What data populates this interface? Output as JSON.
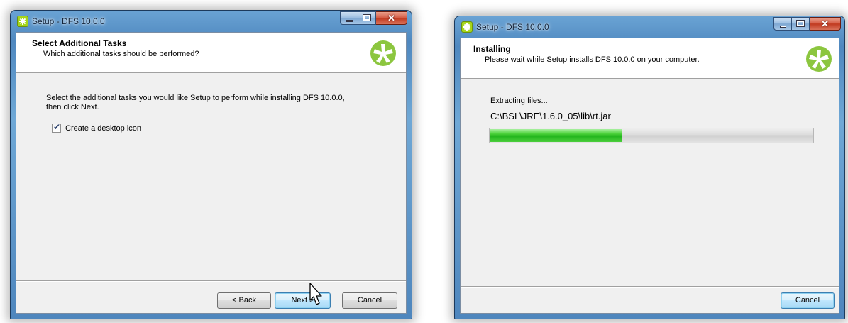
{
  "left_window": {
    "title": "Setup - DFS 10.0.0",
    "header": {
      "title": "Select Additional Tasks",
      "subtitle": "Which additional tasks should be performed?"
    },
    "instruction_line1": "Select the additional tasks you would like Setup to perform while installing DFS 10.0.0,",
    "instruction_line2": "then click Next.",
    "checkbox": {
      "label": "Create a desktop icon",
      "checked": true
    },
    "buttons": {
      "back": "< Back",
      "next": "Next >",
      "cancel": "Cancel"
    }
  },
  "right_window": {
    "title": "Setup - DFS 10.0.0",
    "header": {
      "title": "Installing",
      "subtitle": "Please wait while Setup installs DFS 10.0.0 on your computer."
    },
    "status": "Extracting files...",
    "current_file": "C:\\BSL\\JRE\\1.6.0_05\\lib\\rt.jar",
    "progress_percent": 41,
    "buttons": {
      "cancel": "Cancel"
    }
  },
  "colors": {
    "logo": "#8cc63f",
    "progress": "#2fbd29",
    "frame": "#5d95c8"
  },
  "icons": [
    "app-icon",
    "logo-icon",
    "minimize-icon",
    "maximize-icon",
    "close-icon",
    "checkmark-icon",
    "mouse-cursor-icon"
  ]
}
